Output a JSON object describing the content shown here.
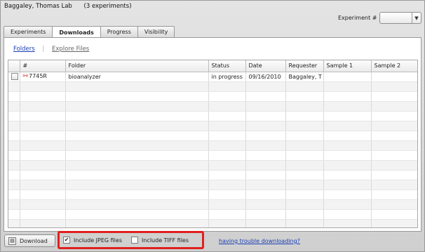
{
  "header": {
    "lab_name": "Baggaley, Thomas Lab",
    "experiment_count": "(3 experiments)"
  },
  "experiment_selector": {
    "label": "Experiment #",
    "value": ""
  },
  "tabs": [
    {
      "label": "Experiments",
      "active": false
    },
    {
      "label": "Downloads",
      "active": true
    },
    {
      "label": "Progress",
      "active": false
    },
    {
      "label": "Visibility",
      "active": false
    }
  ],
  "subnav": {
    "folders": "Folders",
    "separator": "|",
    "explore_files": "Explore Files"
  },
  "table": {
    "columns": [
      "",
      "#",
      "Folder",
      "Status",
      "Date",
      "Requester",
      "Sample 1",
      "Sample 2"
    ],
    "rows": [
      {
        "id": "7745R",
        "folder": "bioanalyzer",
        "status": "in progress",
        "date": "09/16/2010",
        "requester": "Baggaley, T",
        "sample1": "",
        "sample2": ""
      }
    ]
  },
  "footer": {
    "download_label": "Download",
    "include_jpeg": {
      "label": "Include JPEG files",
      "checked": true
    },
    "include_tiff": {
      "label": "Include TIFF files",
      "checked": false
    },
    "trouble_link": "having trouble downloading?"
  },
  "colors": {
    "highlight": "#e02020",
    "link": "#1a3fb4"
  }
}
